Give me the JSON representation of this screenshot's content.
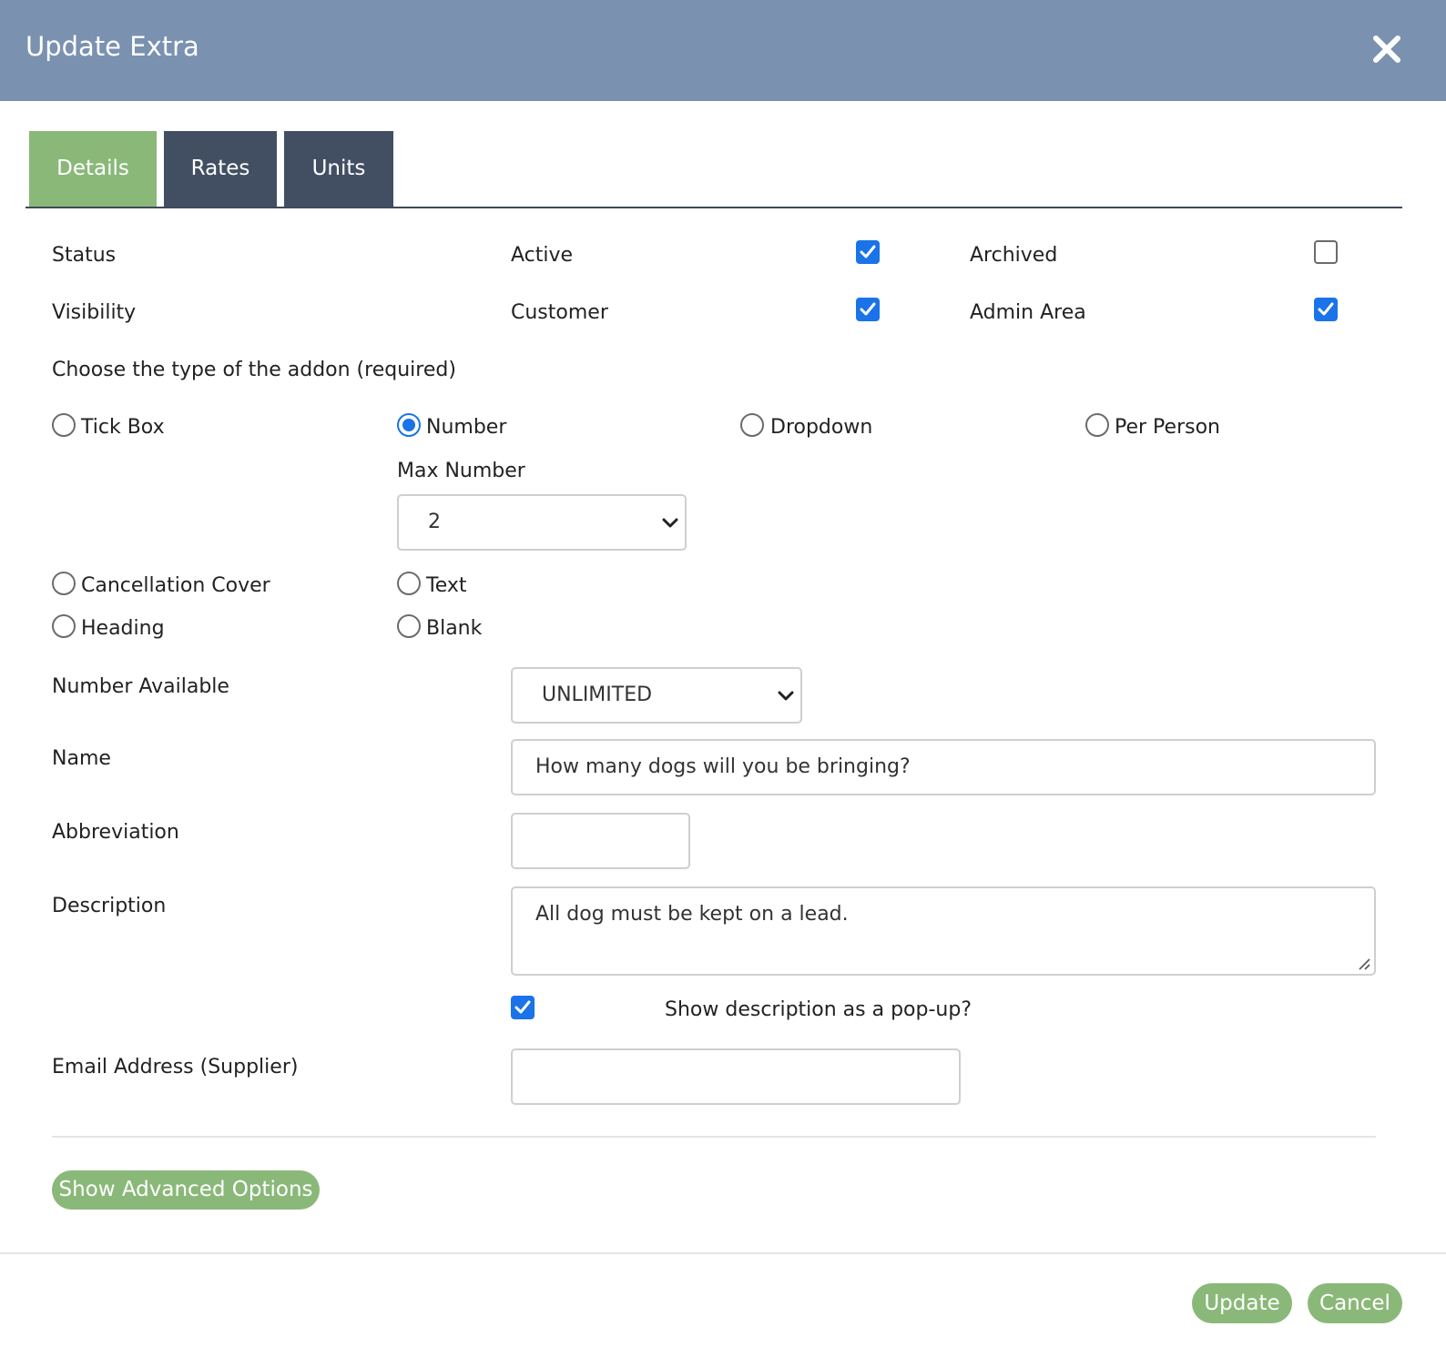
{
  "modal": {
    "title": "Update Extra"
  },
  "tabs": [
    {
      "label": "Details",
      "active": true
    },
    {
      "label": "Rates",
      "active": false
    },
    {
      "label": "Units",
      "active": false
    }
  ],
  "status": {
    "label": "Status",
    "options": [
      {
        "label": "Active",
        "checked": true
      },
      {
        "label": "Archived",
        "checked": false
      }
    ]
  },
  "visibility": {
    "label": "Visibility",
    "options": [
      {
        "label": "Customer",
        "checked": true
      },
      {
        "label": "Admin Area",
        "checked": true
      }
    ]
  },
  "addon_type": {
    "prompt": "Choose the type of the addon (required)",
    "options": [
      {
        "label": "Tick Box",
        "selected": false
      },
      {
        "label": "Number",
        "selected": true
      },
      {
        "label": "Dropdown",
        "selected": false
      },
      {
        "label": "Per Person",
        "selected": false
      },
      {
        "label": "Cancellation Cover",
        "selected": false
      },
      {
        "label": "Text",
        "selected": false
      },
      {
        "label": "Heading",
        "selected": false
      },
      {
        "label": "Blank",
        "selected": false
      }
    ],
    "max_number_label": "Max Number",
    "max_number_value": "2"
  },
  "number_available": {
    "label": "Number Available",
    "value": "UNLIMITED"
  },
  "name": {
    "label": "Name",
    "value": "How many dogs will you be bringing?"
  },
  "abbreviation": {
    "label": "Abbreviation",
    "value": ""
  },
  "description": {
    "label": "Description",
    "value": "All dog must be kept on a lead.",
    "popup_label": "Show description as a pop-up?",
    "popup_checked": true
  },
  "email_supplier": {
    "label": "Email Address (Supplier)",
    "value": ""
  },
  "buttons": {
    "advanced": "Show Advanced Options",
    "update": "Update",
    "cancel": "Cancel"
  },
  "colors": {
    "header": "#7a91b0",
    "tab_active": "#8ab879",
    "tab_inactive": "#424f63",
    "accent": "#1a73e8",
    "button": "#8ab879"
  }
}
